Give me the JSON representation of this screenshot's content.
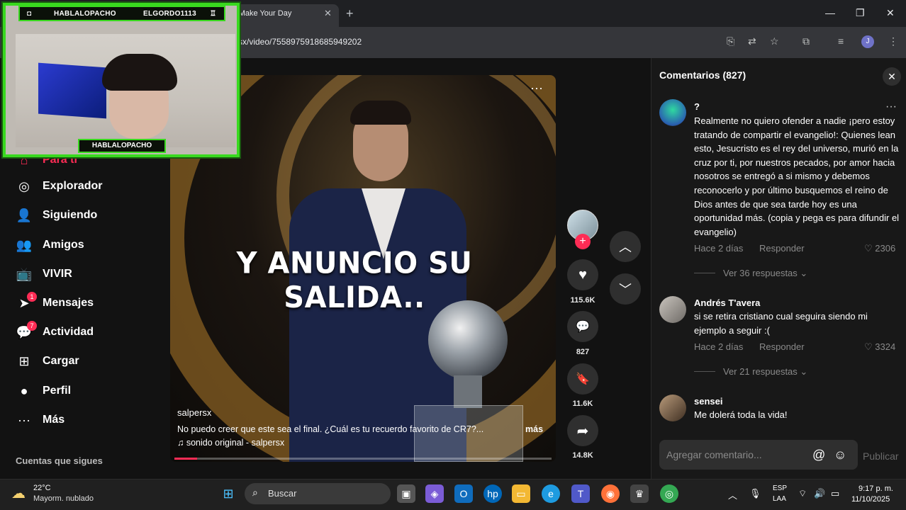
{
  "browser": {
    "tab_title": "- Make Your Day",
    "tab_close": "✕",
    "new_tab": "+",
    "url": "sx/video/7558975918685949202",
    "profile_initial": "J",
    "win_min": "—",
    "win_max": "❐",
    "win_close": "✕"
  },
  "overlay": {
    "top_left": "HABLALOPACHO",
    "top_right": "ELGORDO1113",
    "bottom": "HABLALOPACHO"
  },
  "sidebar": {
    "items": [
      {
        "label": "Para ti",
        "icon": "home-icon",
        "glyph": "⌂"
      },
      {
        "label": "Explorador",
        "icon": "compass-icon",
        "glyph": "◎"
      },
      {
        "label": "Siguiendo",
        "icon": "following-icon",
        "glyph": "👤"
      },
      {
        "label": "Amigos",
        "icon": "friends-icon",
        "glyph": "👥"
      },
      {
        "label": "VIVIR",
        "icon": "live-icon",
        "glyph": "📺"
      },
      {
        "label": "Mensajes",
        "icon": "messages-icon",
        "glyph": "➤",
        "badge": "1"
      },
      {
        "label": "Actividad",
        "icon": "activity-icon",
        "glyph": "💬",
        "badge": "7"
      },
      {
        "label": "Cargar",
        "icon": "upload-icon",
        "glyph": "⊞"
      },
      {
        "label": "Perfil",
        "icon": "profile-icon",
        "glyph": "●"
      },
      {
        "label": "Más",
        "icon": "more-icon",
        "glyph": "···"
      }
    ],
    "following_title": "Cuentas que sigues"
  },
  "video": {
    "caption": "Y ANUNCIO SU SALIDA..",
    "author": "salpersx",
    "description": "No puedo creer que este sea el final. ¿Cuál es tu recuerdo favorito de CR7?...",
    "more": "más",
    "music": "♫  sonido original - salpersx",
    "progress": 0.06,
    "menu": "···"
  },
  "actions": {
    "follow": "+",
    "likes": "115.6K",
    "comments": "827",
    "saves": "11.6K",
    "shares": "14.8K",
    "like_glyph": "♥",
    "comment_glyph": "💬",
    "save_glyph": "🔖",
    "share_glyph": "➦",
    "up_glyph": "︿",
    "down_glyph": "﹀"
  },
  "comments": {
    "title": "Comentarios (827)",
    "close": "✕",
    "items": [
      {
        "name": "?",
        "text": "Realmente no quiero ofender a nadie ¡pero estoy tratando de compartir el evangelio!: Quienes lean esto, Jesucristo es el rey del universo, murió en la cruz por ti, por nuestros pecados, por amor hacia nosotros se entregó a si mismo y debemos reconocerlo y por último busquemos el reino de Dios antes de que sea tarde hoy es una oportunidad más. (copia y pega es para difundir el evangelio)",
        "time": "Hace 2 días",
        "reply": "Responder",
        "likes": "♡ 2306",
        "replies": "Ver 36 respuestas ⌄"
      },
      {
        "name": "Andrés T'avera",
        "text": "si se retira cristiano cual seguira siendo mi ejemplo a seguir :(",
        "time": "Hace 2 días",
        "reply": "Responder",
        "likes": "♡ 3324",
        "replies": "Ver 21 respuestas ⌄"
      },
      {
        "name": "sensei",
        "text": "Me dolerá toda la vida!"
      }
    ],
    "input_placeholder": "Agregar comentario...",
    "at": "@",
    "emoji": "☺",
    "post": "Publicar"
  },
  "taskbar": {
    "temp": "22°C",
    "weather": "Mayorm. nublado",
    "search": "Buscar",
    "lang1": "ESP",
    "lang2": "LAA",
    "time": "9:17 p. m.",
    "date": "11/10/2025"
  },
  "colors": {
    "accent": "#fe2c55",
    "overlay_green": "#39d91f"
  }
}
